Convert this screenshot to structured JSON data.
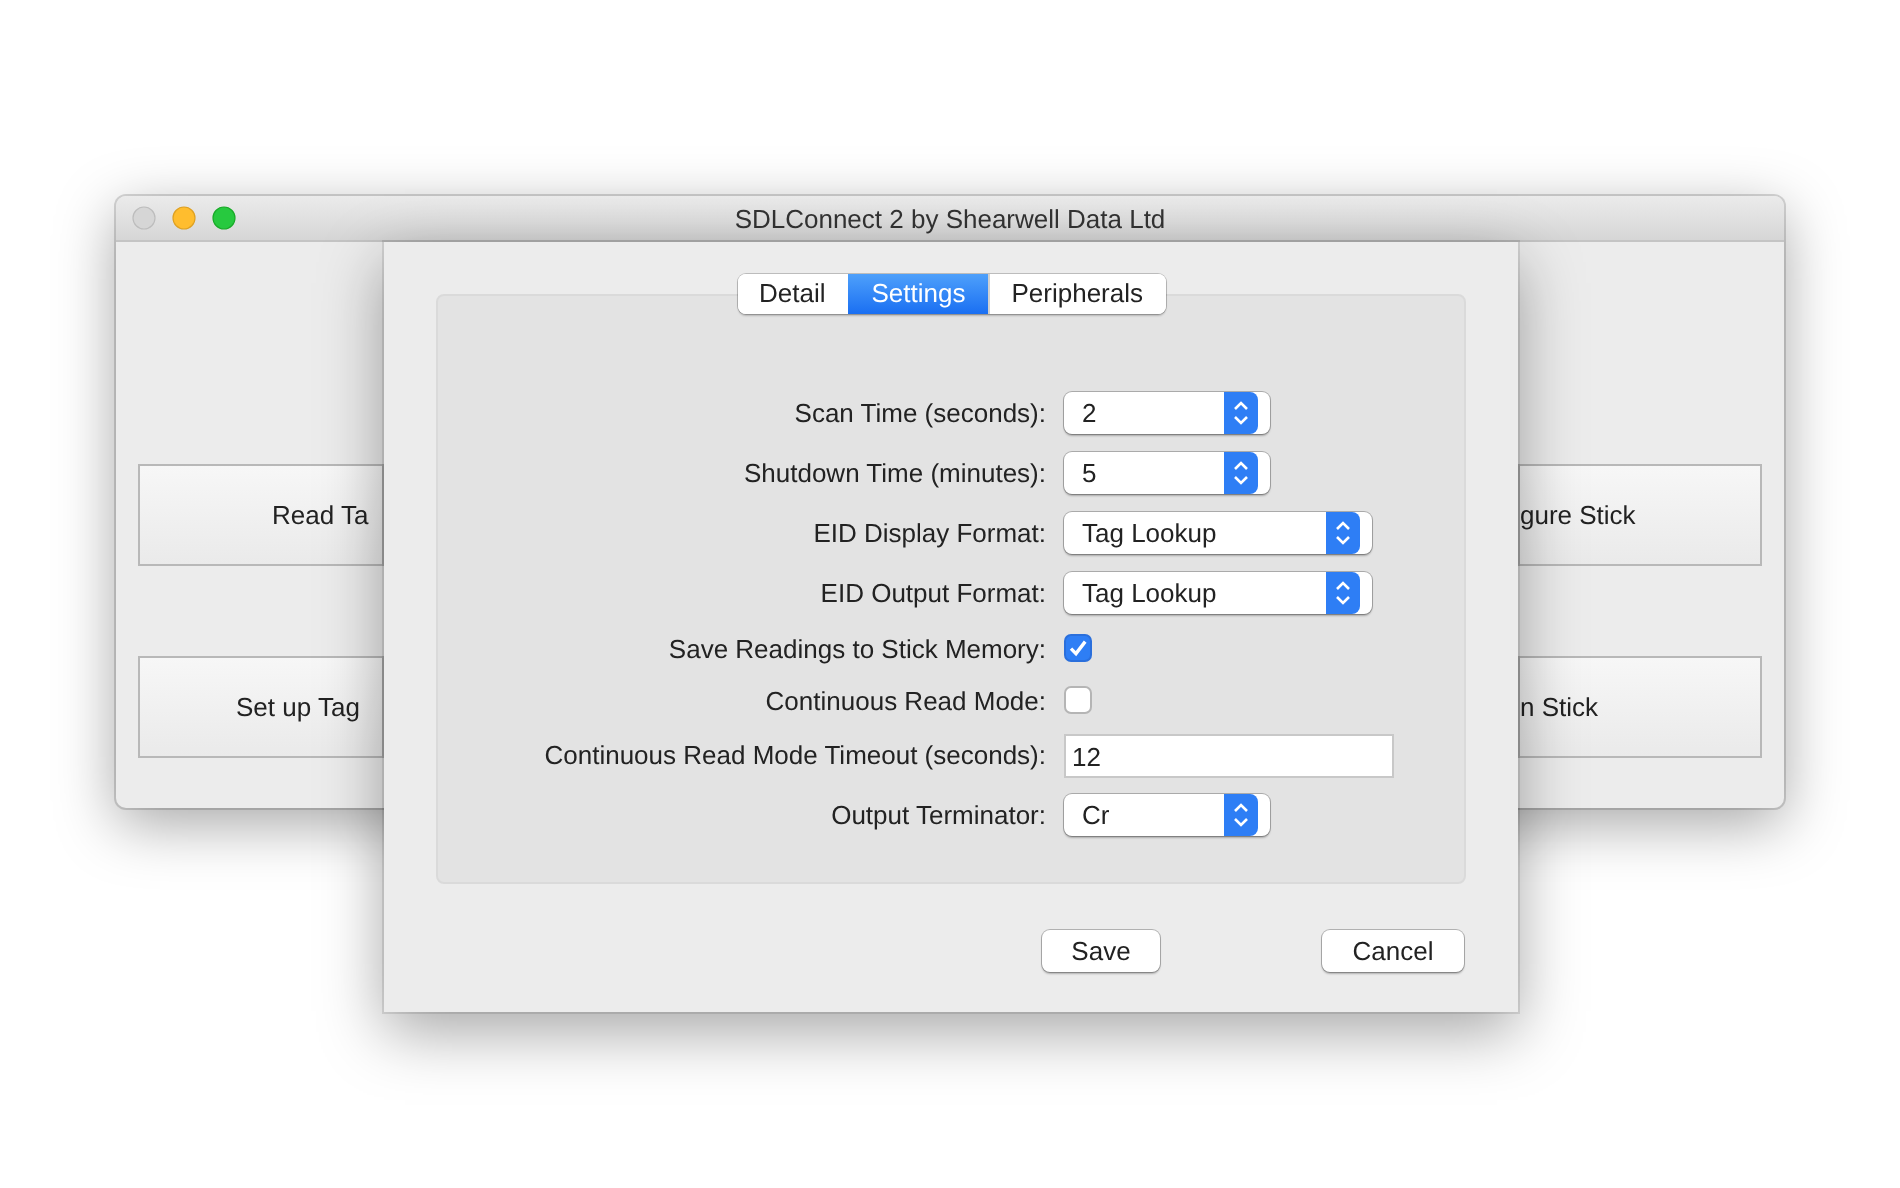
{
  "window": {
    "title": "SDLConnect 2 by Shearwell Data Ltd"
  },
  "main_buttons": [
    {
      "label": "Read Ta"
    },
    {
      "label": "gure Stick"
    },
    {
      "label": "Set up Tag"
    },
    {
      "label": "n Stick"
    }
  ],
  "sheet": {
    "tabs": [
      {
        "label": "Detail",
        "selected": false
      },
      {
        "label": "Settings",
        "selected": true
      },
      {
        "label": "Peripherals",
        "selected": false
      }
    ],
    "settings": [
      {
        "kind": "popup",
        "label": "Scan Time (seconds):",
        "value": "2"
      },
      {
        "kind": "popup",
        "label": "Shutdown Time (minutes):",
        "value": "5"
      },
      {
        "kind": "popup",
        "label": "EID Display Format:",
        "value": "Tag Lookup"
      },
      {
        "kind": "popup",
        "label": "EID Output Format:",
        "value": "Tag Lookup"
      },
      {
        "kind": "checkbox",
        "label": "Save Readings to Stick Memory:",
        "checked": true
      },
      {
        "kind": "checkbox",
        "label": "Continuous Read Mode:",
        "checked": false
      },
      {
        "kind": "text",
        "label": "Continuous Read Mode Timeout (seconds):",
        "value": "12"
      },
      {
        "kind": "popup",
        "label": "Output Terminator:",
        "value": "Cr"
      }
    ],
    "buttons": [
      {
        "label": "Save"
      },
      {
        "label": "Cancel"
      }
    ]
  }
}
